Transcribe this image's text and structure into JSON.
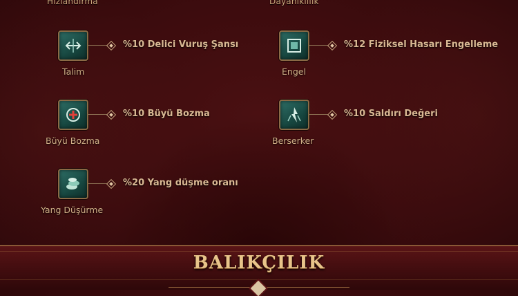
{
  "top_cut_labels": {
    "left": "Hızlandırma",
    "right": "Dayanıklılık"
  },
  "skills": [
    {
      "name": "Talim",
      "bonus": "%10 Delici Vuruş Şansı",
      "icon": "crossed-arrows-icon"
    },
    {
      "name": "Engel",
      "bonus": "%12 Fiziksel Hasarı Engelleme",
      "icon": "shield-frame-icon"
    },
    {
      "name": "Büyü Bozma",
      "bonus": "%10 Büyü Bozma",
      "icon": "magic-break-icon"
    },
    {
      "name": "Berserker",
      "bonus": "%10 Saldırı Değeri",
      "icon": "berserker-icon"
    },
    {
      "name": "Yang Düşürme",
      "bonus": "%20 Yang düşme oranı",
      "icon": "coins-icon"
    }
  ],
  "footer": {
    "title": "BALIKÇILIK"
  },
  "colors": {
    "accent_gold": "#d9b893",
    "icon_teal": "#2e6e66",
    "background": "#3a0b0d"
  }
}
